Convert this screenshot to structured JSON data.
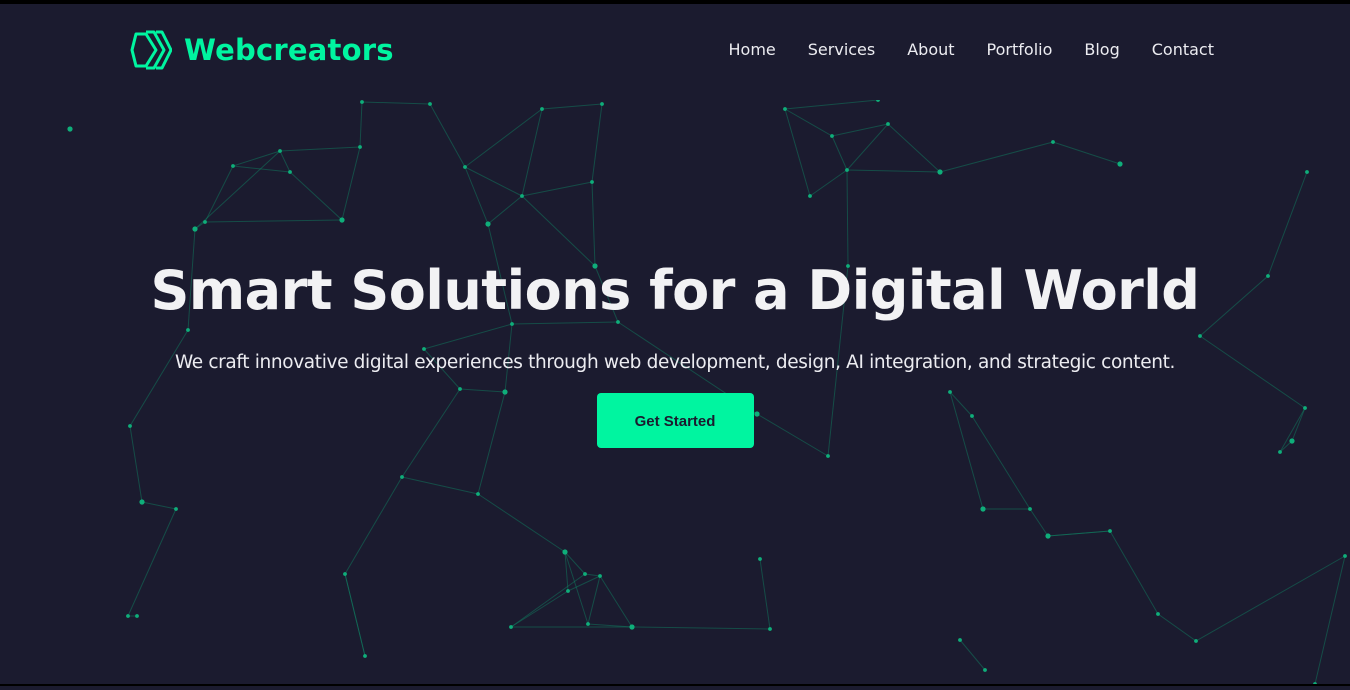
{
  "brand": {
    "name": "Webcreators",
    "accent_color": "#00f5a0",
    "background_color": "#1b1b2f",
    "logo_icon": "chevrons-logo-icon"
  },
  "nav": {
    "items": [
      {
        "label": "Home"
      },
      {
        "label": "Services"
      },
      {
        "label": "About"
      },
      {
        "label": "Portfolio"
      },
      {
        "label": "Blog"
      },
      {
        "label": "Contact"
      }
    ]
  },
  "hero": {
    "title": "Smart Solutions for a Digital World",
    "subtitle": "We craft innovative digital experiences through web development, design, AI integration, and strategic content.",
    "cta_label": "Get Started"
  }
}
